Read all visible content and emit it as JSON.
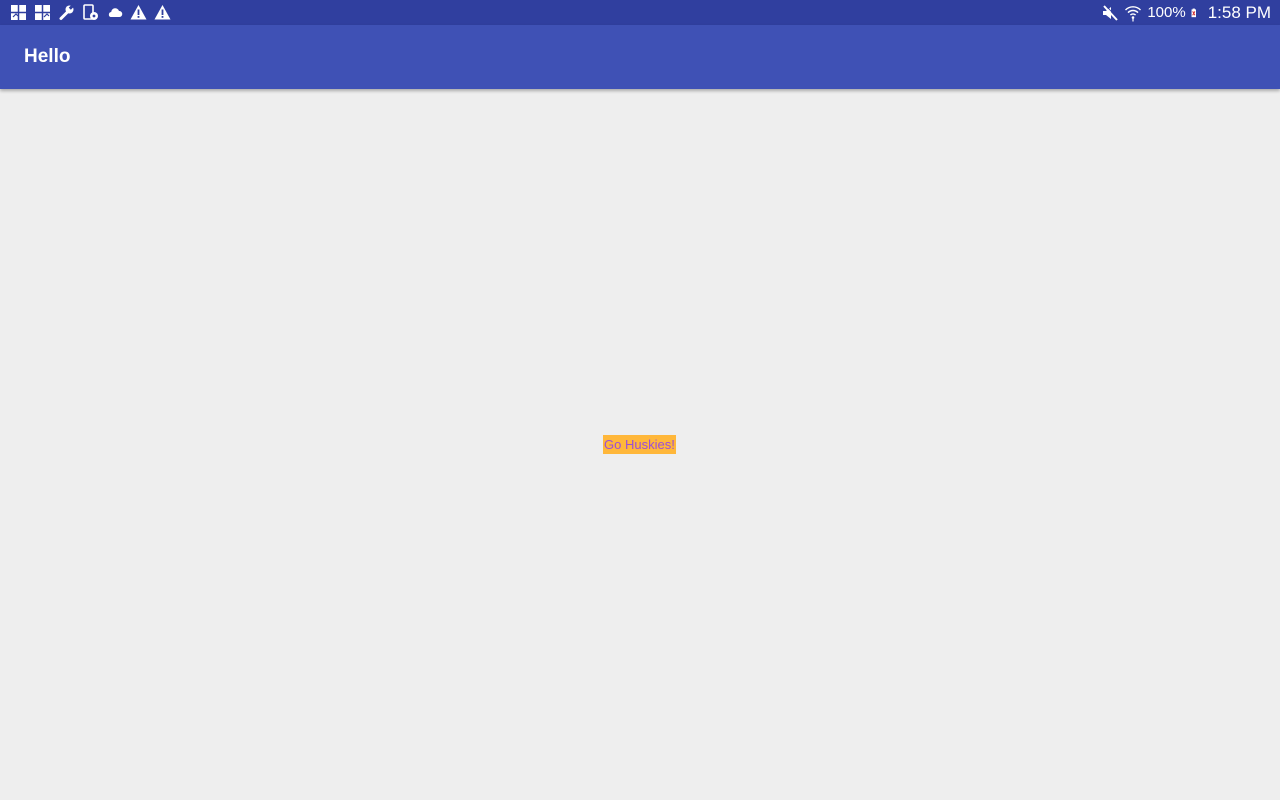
{
  "status_bar": {
    "left_icons": [
      "gallery-icon",
      "gallery-icon",
      "wrench-icon",
      "device-settings-icon",
      "cloud-icon",
      "warning-icon",
      "warning-icon"
    ],
    "right_icons": [
      "mute-icon",
      "wifi-icon",
      "battery-icon"
    ],
    "battery": "100%",
    "time": "1:58 PM",
    "color": "#303f9f"
  },
  "app_bar": {
    "title": "Hello",
    "color": "#3f51b5"
  },
  "content": {
    "label": "Go Huskies!",
    "label_background": "#ffb73a",
    "label_color": "#9c4fd6",
    "background": "#eeeeee"
  }
}
